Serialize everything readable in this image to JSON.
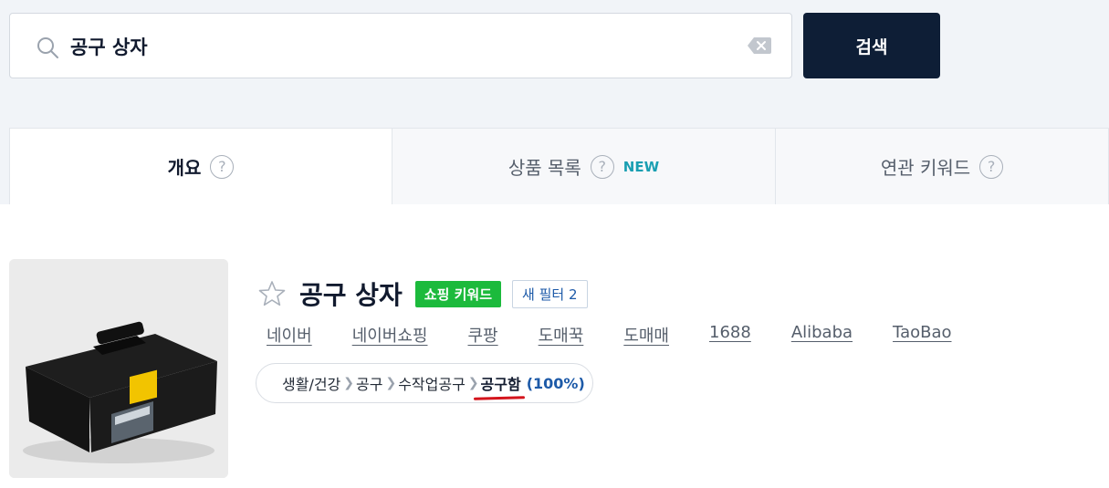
{
  "search": {
    "value": "공구 상자",
    "button_label": "검색"
  },
  "tabs": [
    {
      "label": "개요",
      "help": "?",
      "active": true
    },
    {
      "label": "상품 목록",
      "help": "?",
      "badge": "NEW"
    },
    {
      "label": "연관 키워드",
      "help": "?"
    }
  ],
  "product": {
    "title": "공구 상자",
    "shopping_badge": "쇼핑 키워드",
    "filter_badge": "새 필터 2",
    "favorited": false,
    "image_icon": "toolbox-image"
  },
  "market_links": [
    "네이버",
    "네이버쇼핑",
    "쿠팡",
    "도매꾹",
    "도매매",
    "1688",
    "Alibaba",
    "TaoBao"
  ],
  "category": {
    "path": [
      "생활/건강",
      "공구",
      "수작업공구"
    ],
    "final": "공구함",
    "percent": "(100%)"
  },
  "colors": {
    "search_button": "#0e1e36",
    "shopping_badge": "#1cba3c",
    "new_badge": "#1a9fb2",
    "percent_text": "#1d5aa8",
    "highlight_underline": "#d4141c"
  }
}
